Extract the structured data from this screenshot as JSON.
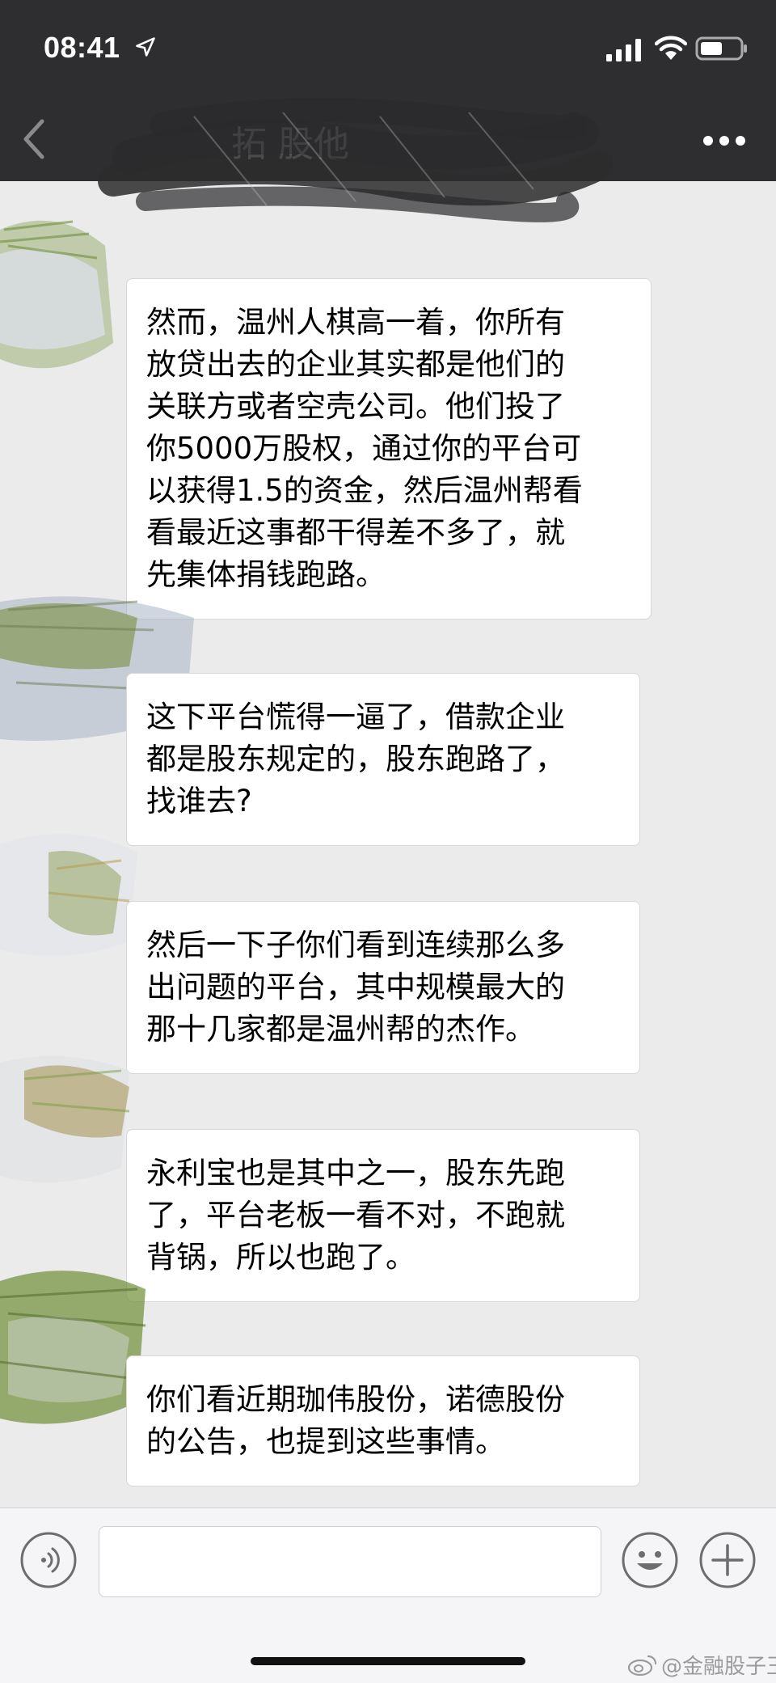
{
  "status_bar": {
    "time": "08:41",
    "icons": [
      "location-arrow-icon",
      "cellular-signal-icon",
      "wifi-icon",
      "battery-icon"
    ]
  },
  "nav": {
    "title_visible_fragment": "拓  股他",
    "back_icon": "chevron-left-icon",
    "more_icon": "more-dots-icon"
  },
  "messages": [
    {
      "lines": [
        "然而，温州人棋高一着，你所有",
        "放贷出去的企业其实都是他们的",
        "关联方或者空壳公司。他们投了",
        "你5000万股权，通过你的平台可",
        "以获得1.5的资金，然后温州帮看",
        "看最近这事都干得差不多了，就",
        "先集体捐钱跑路。"
      ]
    },
    {
      "lines": [
        "这下平台慌得一逼了，借款企业",
        "都是股东规定的，股东跑路了，",
        "找谁去?"
      ]
    },
    {
      "lines": [
        "然后一下子你们看到连续那么多",
        "出问题的平台，其中规模最大的",
        "那十几家都是温州帮的杰作。"
      ]
    },
    {
      "lines": [
        "永利宝也是其中之一，股东先跑",
        "了，平台老板一看不对，不跑就",
        "背锅，所以也跑了。"
      ]
    },
    {
      "lines": [
        "你们看近期珈伟股份，诺德股份",
        "的公告，也提到这些事情。"
      ]
    }
  ],
  "input_bar": {
    "placeholder": "",
    "icons": [
      "voice-wave-icon",
      "emoji-face-icon",
      "plus-icon"
    ]
  },
  "watermark": {
    "text": "@金融股子王",
    "icon": "weibo-logo-icon"
  },
  "colors": {
    "header_bg": "#2e2e30",
    "chat_bg": "#ebebeb",
    "bubble_bg": "#ffffff",
    "input_bar_bg": "#f5f5f7"
  }
}
